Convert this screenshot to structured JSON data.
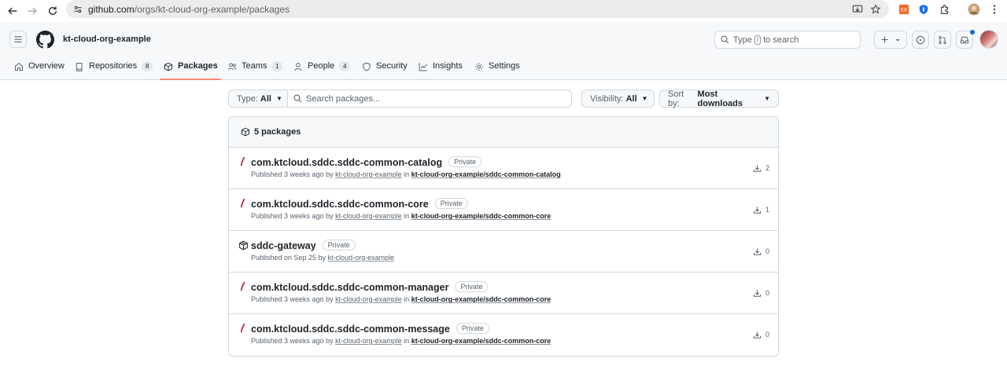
{
  "browser": {
    "url_host": "github.com",
    "url_path": "/orgs/kt-cloud-org-example/packages"
  },
  "header": {
    "org_name": "kt-cloud-org-example",
    "search_prefix": "Type",
    "search_key": "/",
    "search_suffix": "to search"
  },
  "tabs": [
    {
      "label": "Overview",
      "icon": "home-icon"
    },
    {
      "label": "Repositories",
      "count": "8",
      "icon": "repo-icon"
    },
    {
      "label": "Packages",
      "icon": "package-icon",
      "active": true
    },
    {
      "label": "Teams",
      "count": "1",
      "icon": "people-icon"
    },
    {
      "label": "People",
      "count": "4",
      "icon": "person-icon"
    },
    {
      "label": "Security",
      "icon": "shield-icon"
    },
    {
      "label": "Insights",
      "icon": "graph-icon"
    },
    {
      "label": "Settings",
      "icon": "gear-icon"
    }
  ],
  "filters": {
    "type_label": "Type:",
    "type_value": "All",
    "search_placeholder": "Search packages...",
    "visibility_label": "Visibility:",
    "visibility_value": "All",
    "sort_label": "Sort by:",
    "sort_value": "Most downloads"
  },
  "packages": {
    "count_label": "5 packages",
    "items": [
      {
        "name": "com.ktcloud.sddc.sddc-common-catalog",
        "badge": "Private",
        "icon": "maven-icon",
        "published": "Published 3 weeks ago by",
        "by": "kt-cloud-org-example",
        "in_text": "in",
        "repo": "kt-cloud-org-example/sddc-common-catalog",
        "downloads": "2"
      },
      {
        "name": "com.ktcloud.sddc.sddc-common-core",
        "badge": "Private",
        "icon": "maven-icon",
        "published": "Published 3 weeks ago by",
        "by": "kt-cloud-org-example",
        "in_text": "in",
        "repo": "kt-cloud-org-example/sddc-common-core",
        "downloads": "1"
      },
      {
        "name": "sddc-gateway",
        "badge": "Private",
        "icon": "container-icon",
        "published": "Published on Sep 25 by",
        "by": "kt-cloud-org-example",
        "in_text": "",
        "repo": "",
        "downloads": "0"
      },
      {
        "name": "com.ktcloud.sddc.sddc-common-manager",
        "badge": "Private",
        "icon": "maven-icon",
        "published": "Published 3 weeks ago by",
        "by": "kt-cloud-org-example",
        "in_text": "in",
        "repo": "kt-cloud-org-example/sddc-common-core",
        "downloads": "0"
      },
      {
        "name": "com.ktcloud.sddc.sddc-common-message",
        "badge": "Private",
        "icon": "maven-icon",
        "published": "Published 3 weeks ago by",
        "by": "kt-cloud-org-example",
        "in_text": "in",
        "repo": "kt-cloud-org-example/sddc-common-core",
        "downloads": "0"
      }
    ]
  },
  "colors": {
    "tab_underline": "#fd8c73",
    "maven_icon": "#c71a36",
    "notification_dot": "#0969da"
  }
}
